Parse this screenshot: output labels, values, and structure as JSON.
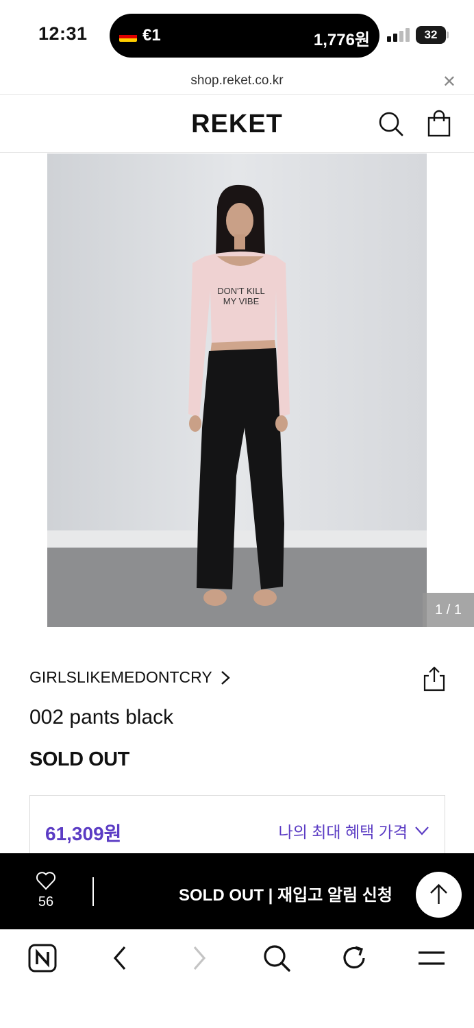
{
  "status": {
    "time": "12:31",
    "currency_left": "€1",
    "currency_right": "1,776원",
    "battery": "32"
  },
  "browser": {
    "url": "shop.reket.co.kr",
    "close_icon": "close-icon"
  },
  "header": {
    "logo": "REKET",
    "icons": [
      "search-icon",
      "shopping-bag-icon"
    ]
  },
  "gallery": {
    "counter": "1 / 1",
    "print_line1": "DON'T KILL",
    "print_line2": "MY VIBE"
  },
  "product": {
    "brand": "GIRLSLIKEMEDONTCRY",
    "name": "002 pants black",
    "status": "SOLD OUT",
    "price": "61,309원",
    "benefit_label": "나의 최대 혜택 가격"
  },
  "action_bar": {
    "likes": "56",
    "notify_label": "SOLD OUT | 재입고 알림 신청"
  },
  "colors": {
    "accent": "#5b3cc4",
    "bar": "#000000"
  },
  "toolbar": {
    "icons": [
      "naver-icon",
      "back-icon",
      "forward-icon",
      "search-icon",
      "refresh-icon",
      "menu-icon"
    ]
  }
}
